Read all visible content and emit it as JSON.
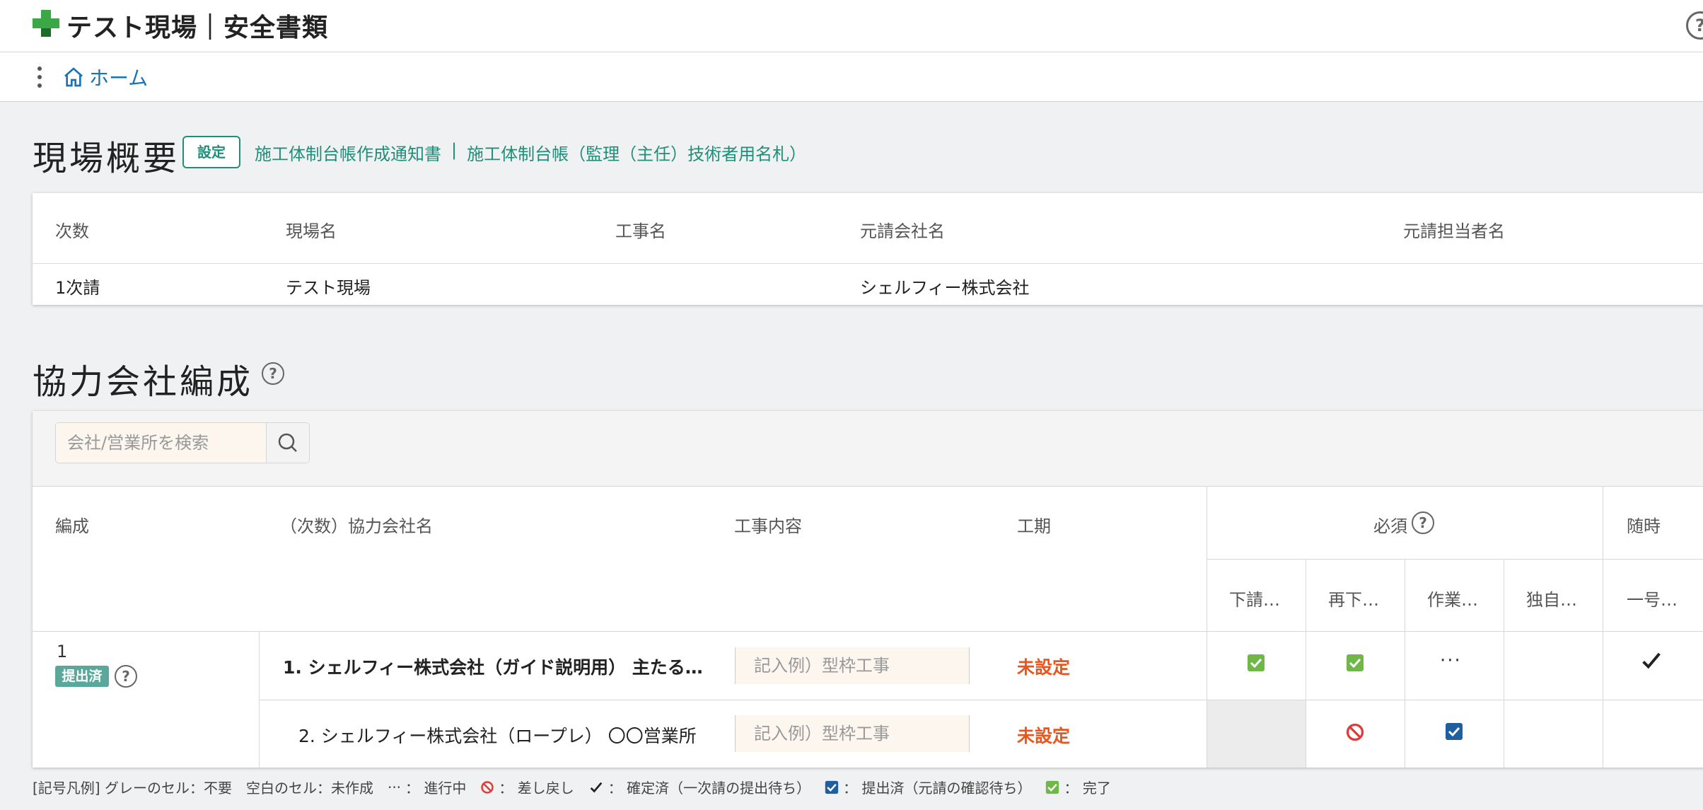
{
  "app": {
    "title": "テスト現場｜安全書類"
  },
  "nav": {
    "home": "ホーム"
  },
  "overview": {
    "title": "現場概要",
    "settings_label": "設定",
    "link1": "施工体制台帳作成通知書",
    "separator": "|",
    "link2": "施工体制台帳（監理（主任）技術者用名札）",
    "headers": {
      "order": "次数",
      "site": "現場名",
      "work": "工事名",
      "prime": "元請会社名",
      "contact": "元請担当者名"
    },
    "row": {
      "order": "1次請",
      "site": "テスト現場",
      "work": "",
      "prime": "シェルフィー株式会社",
      "contact": ""
    }
  },
  "partners": {
    "title": "協力会社編成",
    "search_placeholder": "会社/営業所を検索",
    "headers": {
      "group": "編成",
      "company": "（次数）協力会社名",
      "content": "工事内容",
      "period": "工期",
      "required": "必須",
      "anytime": "随時",
      "sub1": "下請…",
      "sub2": "再下…",
      "sub3": "作業…",
      "sub4": "独自…",
      "sub5": "一号…"
    },
    "group": {
      "number": "1",
      "status": "提出済"
    },
    "rows": [
      {
        "name": "1. シェルフィー株式会社（ガイド説明用） 主たる…",
        "content_placeholder": "記入例）型枠工事",
        "period": "未設定",
        "c3": "···"
      },
      {
        "name": "2. シェルフィー株式会社（ロープレ） 〇〇営業所",
        "content_placeholder": "記入例）型枠工事",
        "period": "未設定"
      }
    ]
  },
  "legend": {
    "prefix": "[記号凡例] グレーのセル：不要　空白のセル：未作成",
    "dots": "···",
    "in_progress": "： 進行中",
    "returned": "： 差し戻し",
    "confirmed": "： 確定済（一次請の提出待ち）",
    "submitted": "： 提出済（元請の確認待ち）",
    "complete": "： 完了"
  },
  "colors": {
    "accent": "#1f8f7a",
    "link": "#1a73b5",
    "logo": "#3aa845",
    "warning": "#e8561e",
    "badge": "#5aa89c"
  }
}
